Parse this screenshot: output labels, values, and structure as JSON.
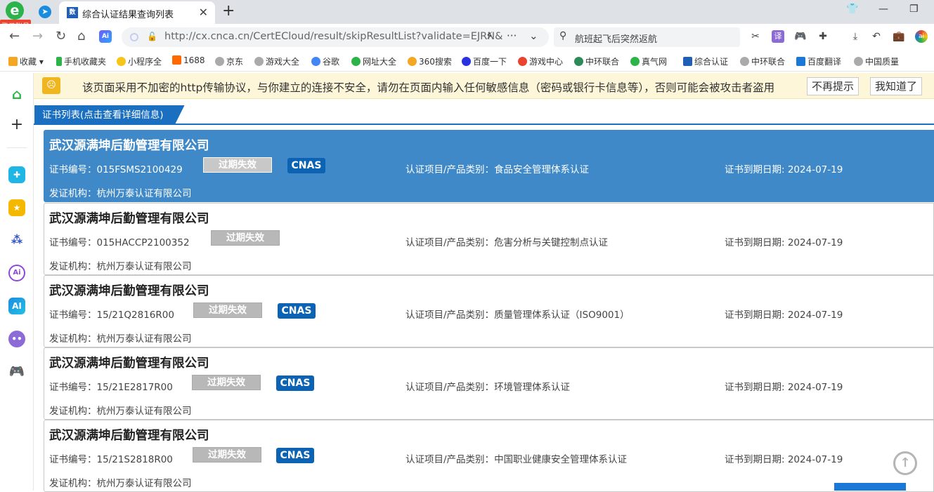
{
  "browser": {
    "login_label": "登录账号",
    "tab_title": "综合认证结果查询列表",
    "tab_favicon": "数",
    "url": "http://cx.cnca.cn/CertECloud/result/skipResultList?validate=EJRN&",
    "search_text": "航班起飞后突然返航",
    "ai_label": "Ai"
  },
  "bookmarks": [
    {
      "label": "收藏",
      "color": "#f5a623"
    },
    {
      "label": "手机收藏夹",
      "color": "#2cb34a"
    },
    {
      "label": "小程序全",
      "color": "#f5c518"
    },
    {
      "label": "1688",
      "color": "#ff6a00"
    },
    {
      "label": "京东",
      "color": "#999999"
    },
    {
      "label": "游戏大全",
      "color": "#999999"
    },
    {
      "label": "谷歌",
      "color": "#4285f4"
    },
    {
      "label": "网址大全",
      "color": "#2cb34a"
    },
    {
      "label": "360搜索",
      "color": "#f5a623"
    },
    {
      "label": "百度一下",
      "color": "#2932e1"
    },
    {
      "label": "游戏中心",
      "color": "#e8442f"
    },
    {
      "label": "中环联合",
      "color": "#2e8b57"
    },
    {
      "label": "真气网",
      "color": "#2cb34a"
    },
    {
      "label": "综合认证",
      "color": "#1f5fb8"
    },
    {
      "label": "中环联合",
      "color": "#999999"
    },
    {
      "label": "百度翻译",
      "color": "#1a78d6"
    },
    {
      "label": "中国质量",
      "color": "#999999"
    }
  ],
  "warning": {
    "text": "该页面采用不加密的http传输协议，与你建立的连接不安全，请勿在页面内输入任何敏感信息（密码或银行卡信息等），否则可能会被攻击者盗用",
    "dismiss_label": "不再提示",
    "ok_label": "我知道了"
  },
  "section_title": "证书列表(点击查看详细信息)",
  "labels": {
    "cert_no": "证书编号：",
    "project": "认证项目/产品类别：",
    "expire": "证书到期日期: ",
    "issuer": "发证机构："
  },
  "certificates": [
    {
      "company": "武汉源满坤后勤管理有限公司",
      "cert_no": "015FSMS2100429",
      "status": "过期失效",
      "cnas": "CNAS",
      "project": "食品安全管理体系认证",
      "expire": "2024-07-19",
      "issuer": "杭州万泰认证有限公司"
    },
    {
      "company": "武汉源满坤后勤管理有限公司",
      "cert_no": "015HACCP2100352",
      "status": "过期失效",
      "cnas": "",
      "project": "危害分析与关键控制点认证",
      "expire": "2024-07-19",
      "issuer": "杭州万泰认证有限公司"
    },
    {
      "company": "武汉源满坤后勤管理有限公司",
      "cert_no": "15/21Q2816R00",
      "status": "过期失效",
      "cnas": "CNAS",
      "project": "质量管理体系认证（ISO9001）",
      "expire": "2024-07-19",
      "issuer": "杭州万泰认证有限公司"
    },
    {
      "company": "武汉源满坤后勤管理有限公司",
      "cert_no": "15/21E2817R00",
      "status": "过期失效",
      "cnas": "CNAS",
      "project": "环境管理体系认证",
      "expire": "2024-07-19",
      "issuer": "杭州万泰认证有限公司"
    },
    {
      "company": "武汉源满坤后勤管理有限公司",
      "cert_no": "15/21S2818R00",
      "status": "过期失效",
      "cnas": "CNAS",
      "project": "中国职业健康安全管理体系认证",
      "expire": "2024-07-19",
      "issuer": "杭州万泰认证有限公司"
    }
  ]
}
